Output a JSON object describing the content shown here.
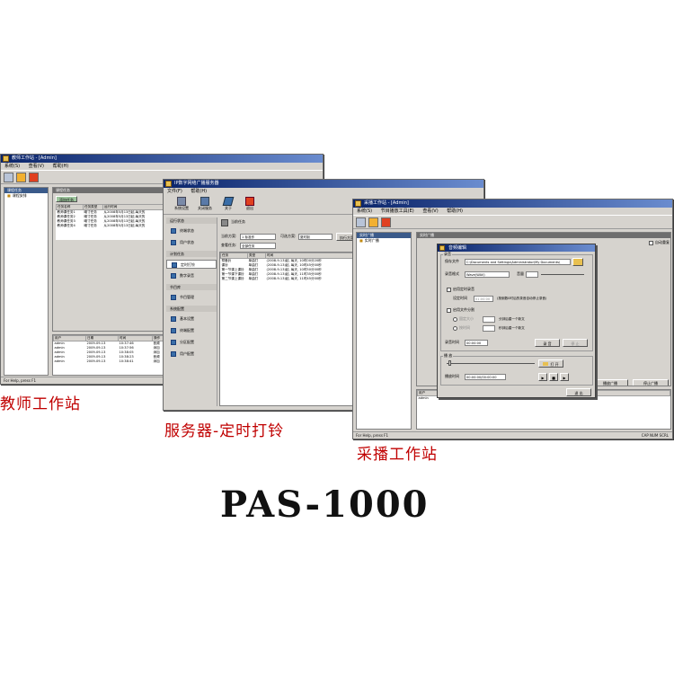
{
  "teacher": {
    "title": "教师工作站 - [Admin]",
    "menu": [
      "系统(S)",
      "查看(V)",
      "帮助(H)"
    ],
    "tree_header": "课程任务",
    "tree_items": [
      "课程安排"
    ],
    "content_header": "课程任务",
    "new_task_button": "添加任务",
    "task_columns": [
      "任务名称",
      "任务类型",
      "运行时间"
    ],
    "task_rows": [
      [
        "教师课任务1",
        "曦寸任务",
        "从2008年5月13日起,每天的"
      ],
      [
        "教师课任务2",
        "曦寸任务",
        "从2008年5月13日起,每天的"
      ],
      [
        "教师课任务3",
        "曦寸任务",
        "从2008年5月13日起,每天的"
      ],
      [
        "教师课任务4",
        "曦寸任务",
        "从2008年5月13日起,每天的"
      ]
    ],
    "log_columns": [
      "用户",
      "日期",
      "时间",
      "操作"
    ],
    "log_rows": [
      [
        "admin",
        "2009-09-13",
        "10:37:46",
        "音频"
      ],
      [
        "admin",
        "2009-09-13",
        "10:37:56",
        "添加"
      ],
      [
        "admin",
        "2009-09-13",
        "10:38:05",
        "添加"
      ],
      [
        "admin",
        "2009-09-13",
        "10:38:23",
        "音频"
      ],
      [
        "admin",
        "2009-09-13",
        "10:38:41",
        "添加"
      ]
    ],
    "status": "For Help, press F1"
  },
  "server": {
    "title": "IP数字网络广播服务器",
    "menu": [
      "文件(F)",
      "帮助(H)"
    ],
    "toolbar": [
      "系统设置",
      "关闭服务",
      "关于",
      "退出"
    ],
    "active_tool": "当前任务",
    "nav": {
      "group1": "运行状态",
      "items1": [
        "终端状态",
        "用户状态"
      ],
      "group2": "计划任务",
      "items2": [
        "定时打铃",
        "数字录音"
      ],
      "group3": "节目库",
      "items3": [
        "节目管理"
      ],
      "group4": "系统配置",
      "items4": [
        "基本设置",
        "终端配置",
        "分区配置",
        "用户配置"
      ]
    },
    "filter": {
      "scheme_label": "当前方案:",
      "scheme_value": "1 标准作",
      "status_label": "可选方案:",
      "status_value": "夏时制",
      "type_label": "查看任务:",
      "type_value": "全部任务",
      "run_button": "执行方案"
    },
    "columns": [
      "任务",
      "类型",
      "时间"
    ],
    "rows": [
      [
        "预备铃",
        "单曲打",
        "(2008-9-13)起, 每天, 10时00分20秒"
      ],
      [
        "课铃",
        "单曲打",
        "(2008-9-13)起, 每天, 10时45分00秒"
      ],
      [
        "第一节课上课铃",
        "单曲打",
        "(2008-9-13)起, 每天, 10时50分00秒"
      ],
      [
        "第一节课下课铃",
        "单曲打",
        "(2008-9-13)起, 每天, 11时35分00秒"
      ],
      [
        "第二节课上课铃",
        "单曲打",
        "(2008-9-13)起, 每天, 11时45分00秒"
      ]
    ]
  },
  "broadcast": {
    "title": "采播工作站 - [Admin]",
    "menu": [
      "系统(S)",
      "节目播放工具(E)",
      "查看(V)",
      "帮助(H)"
    ],
    "tree_header": "实时广播",
    "tree_items": [
      "实时广播"
    ],
    "content_header": "实时广播",
    "auto_retry": "自动重复",
    "user_col": "用户",
    "user_row": "admin",
    "status_left": "For Help, press F1",
    "status_right": "CAP NUM SCRL",
    "dialog": {
      "title": "音频编辑",
      "group": "录音",
      "save_label": "保存文件",
      "save_path": "C:\\Documents and Settings\\Administrator\\My Documents\\",
      "format_label": "录音格式",
      "format_value": "Wave(WAV)",
      "volume_label": "音量",
      "timed_record": "启用定时录音",
      "set_time": "设定时间",
      "time_value": "01:00:00",
      "hint": "(按倒数0时后的录音自动停止录音)",
      "split_label": "启用文件分割",
      "by_size": "固定大小",
      "size_unit": "分钟后建一个新文",
      "by_time": "按时间",
      "time_unit": "秒钟后建一个新文",
      "record_time_label": "录音时间",
      "record_time_value": "00:00:00",
      "record_button": "录 音",
      "stop_button": "停 止",
      "play_group": "播 放",
      "open_button": "打 开",
      "play_time_label": "播放时间",
      "play_time_value": "00:00:00/00:00:00",
      "play_button": "▶",
      "pause_button": "■",
      "next_button": "▶",
      "close_button": "退 出"
    },
    "bg_buttons": [
      "播放广播",
      "停止广播"
    ]
  },
  "captions": {
    "teacher": "教师工作站",
    "server": "服务器-定时打铃",
    "broadcast": "采播工作站"
  },
  "model": "PAS-1000"
}
